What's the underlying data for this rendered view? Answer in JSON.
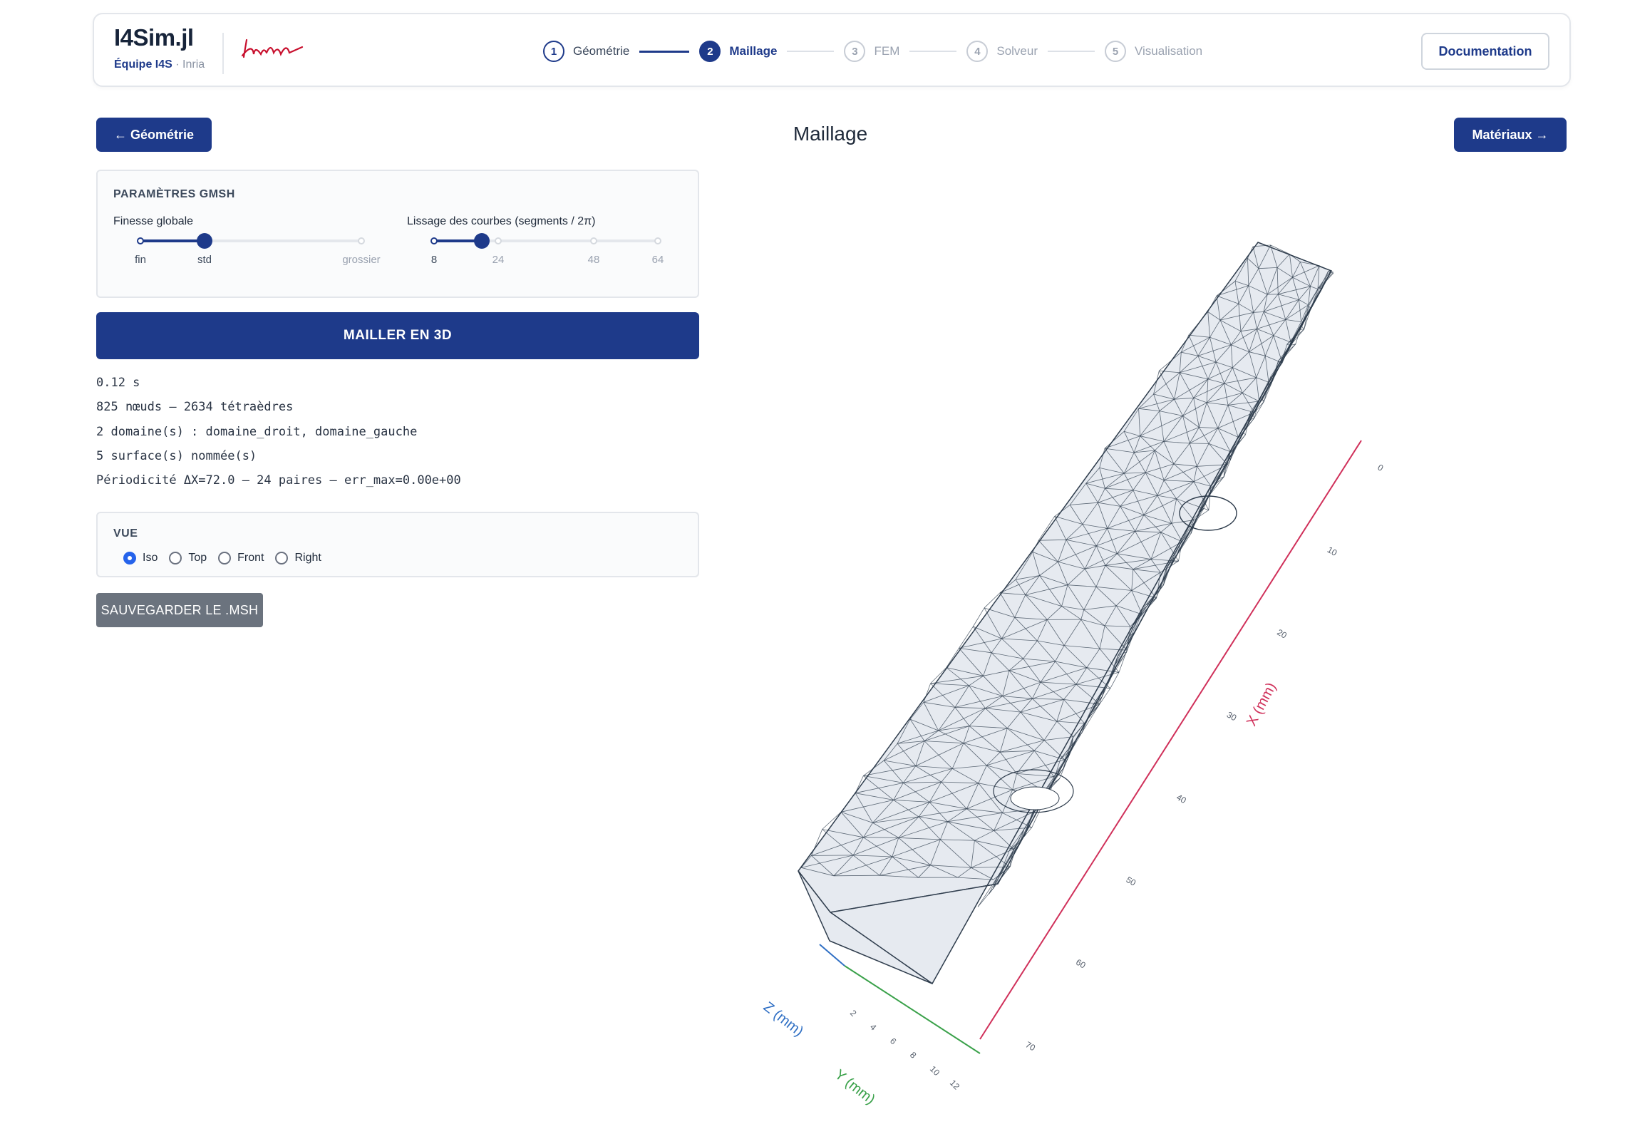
{
  "header": {
    "app_title": "I4Sim.jl",
    "team": "Équipe I4S",
    "separator": " · ",
    "org": "Inria",
    "logo_text": "Inria",
    "steps": [
      {
        "num": "1",
        "label": "Géométrie",
        "state": "done"
      },
      {
        "num": "2",
        "label": "Maillage",
        "state": "active"
      },
      {
        "num": "3",
        "label": "FEM",
        "state": "todo"
      },
      {
        "num": "4",
        "label": "Solveur",
        "state": "todo"
      },
      {
        "num": "5",
        "label": "Visualisation",
        "state": "todo"
      }
    ],
    "documentation_label": "Documentation"
  },
  "nav": {
    "prev_label": "← Géométrie",
    "next_label": "Matériaux →",
    "page_title": "Maillage"
  },
  "params": {
    "title": "PARAMÈTRES GMSH",
    "finesse": {
      "label": "Finesse globale",
      "ticks": [
        "fin",
        "std",
        "grossier"
      ],
      "selected": "std"
    },
    "lissage": {
      "label": "Lissage des courbes (segments / 2π)",
      "ticks": [
        "8",
        "24",
        "48",
        "64"
      ],
      "selected": "24"
    }
  },
  "actions": {
    "mesh_label": "MAILLER EN 3D",
    "save_label": "SAUVEGARDER LE .MSH"
  },
  "output": [
    "0.12 s",
    "825 nœuds — 2634 tétraèdres",
    "2 domaine(s) : domaine_droit, domaine_gauche",
    "5 surface(s) nommée(s)",
    "Périodicité ΔX=72.0 — 24 paires — err_max=0.00e+00"
  ],
  "view": {
    "title": "VUE",
    "options": [
      "Iso",
      "Top",
      "Front",
      "Right"
    ],
    "selected": "Iso"
  },
  "viewer": {
    "x_axis_label": "X (mm)",
    "y_axis_label": "Y (mm)",
    "z_axis_label": "Z (mm)",
    "x_ticks": [
      "0",
      "10",
      "20",
      "30",
      "40",
      "50",
      "60",
      "70"
    ],
    "y_ticks": [
      "2",
      "4",
      "6",
      "8",
      "10",
      "12"
    ],
    "colors": {
      "x_axis": "#d0305a",
      "y_axis": "#3aa14a",
      "z_axis": "#2f6fc4",
      "mesh": "#2f3d4d",
      "fill": "#e6eaf0"
    }
  },
  "colors": {
    "primary": "#1e3a8a",
    "save_button": "#6b737e",
    "inria_red": "#c8102e"
  }
}
